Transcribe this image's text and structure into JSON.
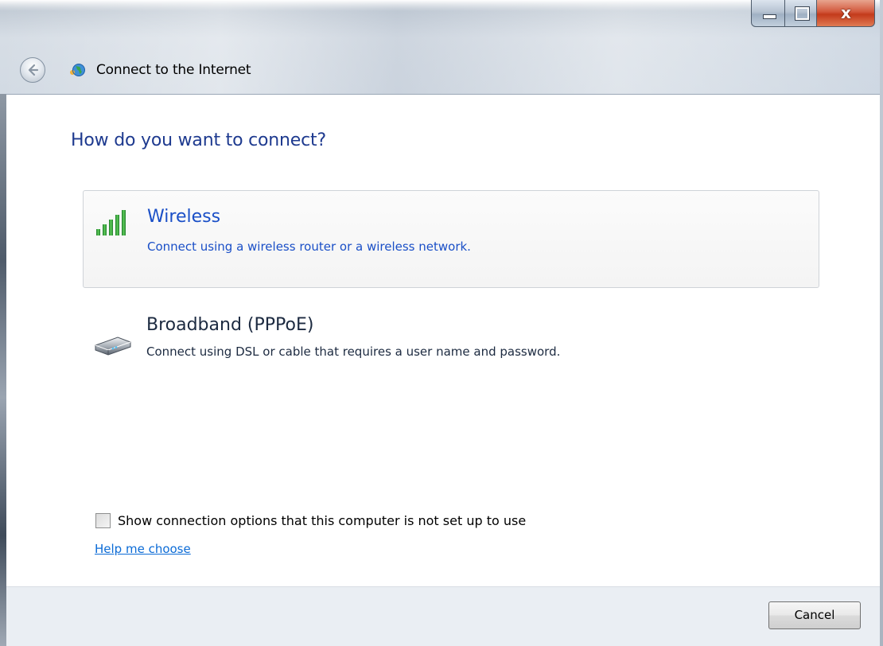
{
  "window": {
    "title": "Connect to the Internet",
    "caption_buttons": {
      "minimize_icon": "minimize-icon",
      "maximize_icon": "maximize-icon",
      "close_glyph": "x"
    }
  },
  "main": {
    "heading": "How do you want to connect?",
    "options": [
      {
        "title": "Wireless",
        "description": "Connect using a wireless router or a wireless network.",
        "icon": "wireless-signal-icon",
        "selected": true
      },
      {
        "title": "Broadband (PPPoE)",
        "description": "Connect using DSL or cable that requires a user name and password.",
        "icon": "modem-icon",
        "selected": false
      }
    ],
    "show_options_label": "Show connection options that this computer is not set up to use",
    "show_options_checked": false,
    "help_link": "Help me choose"
  },
  "footer": {
    "cancel_label": "Cancel"
  },
  "colors": {
    "heading": "#1e3a8f",
    "selected_option_text": "#1a4fc7",
    "link": "#0b6bd6",
    "close_button": "#c33a1b"
  }
}
